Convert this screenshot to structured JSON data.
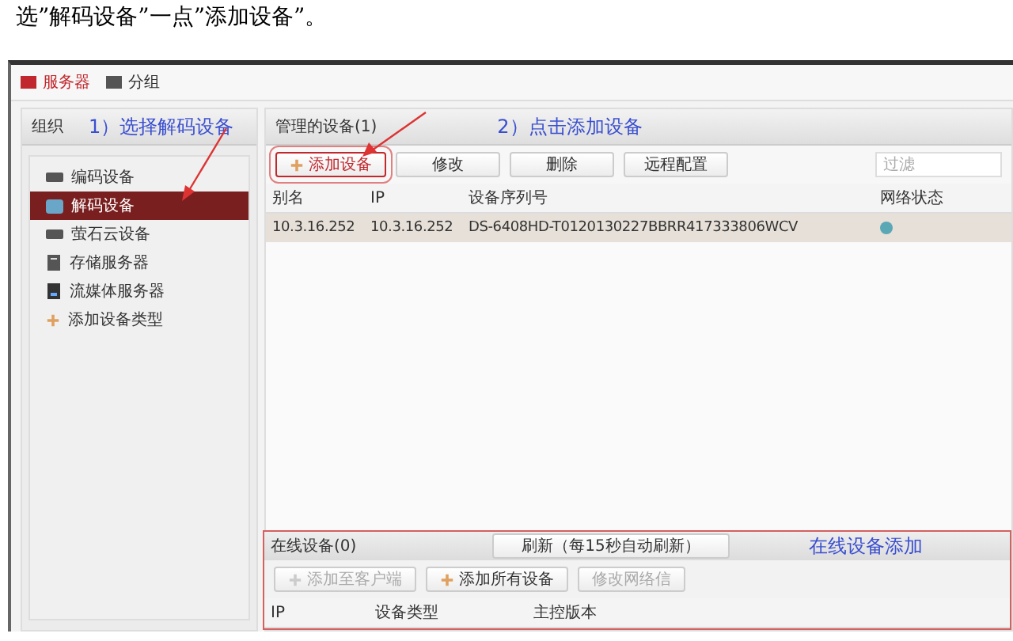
{
  "caption": "选”解码设备”一点”添加设备”。",
  "tabs": [
    {
      "label": "服务器",
      "selected": true
    },
    {
      "label": "分组",
      "selected": false
    }
  ],
  "left_panel": {
    "title": "组织",
    "annotation": "1）选择解码设备",
    "items": [
      {
        "label": "编码设备",
        "kind": "device",
        "selected": false
      },
      {
        "label": "解码设备",
        "kind": "decoder",
        "selected": true
      },
      {
        "label": "萤石云设备",
        "kind": "device",
        "selected": false
      },
      {
        "label": "存储服务器",
        "kind": "storage",
        "selected": false
      },
      {
        "label": "流媒体服务器",
        "kind": "stream",
        "selected": false
      },
      {
        "label": "添加设备类型",
        "kind": "add",
        "selected": false
      }
    ]
  },
  "devices": {
    "title": "管理的设备(1)",
    "annotation": "2）点击添加设备",
    "buttons": [
      {
        "label": "添加设备",
        "highlighted": true,
        "kind": "add"
      },
      {
        "label": "修改",
        "highlighted": false,
        "kind": "plain"
      },
      {
        "label": "删除",
        "highlighted": false,
        "kind": "plain"
      },
      {
        "label": "远程配置",
        "highlighted": false,
        "kind": "plain"
      }
    ],
    "filter": {
      "placeholder": "过滤"
    },
    "columns": [
      "别名",
      "IP",
      "设备序列号",
      "网络状态"
    ],
    "rows": [
      {
        "cells": [
          "10.3.16.252",
          "10.3.16.252",
          "DS-6408HD-T0120130227BBRR417333806WCV"
        ],
        "selected": true
      }
    ]
  },
  "online": {
    "title": "在线设备(0)",
    "refresh_button": "刷新（每15秒自动刷新）",
    "annotation": "在线设备添加",
    "buttons": [
      {
        "label": "添加至客户端",
        "disabled": true,
        "kind": "add"
      },
      {
        "label": "添加所有设备",
        "disabled": false,
        "kind": "add"
      },
      {
        "label": "修改网络信",
        "disabled": true,
        "kind": "plain"
      }
    ],
    "columns": [
      "IP",
      "设备类型",
      "主控版本"
    ]
  }
}
